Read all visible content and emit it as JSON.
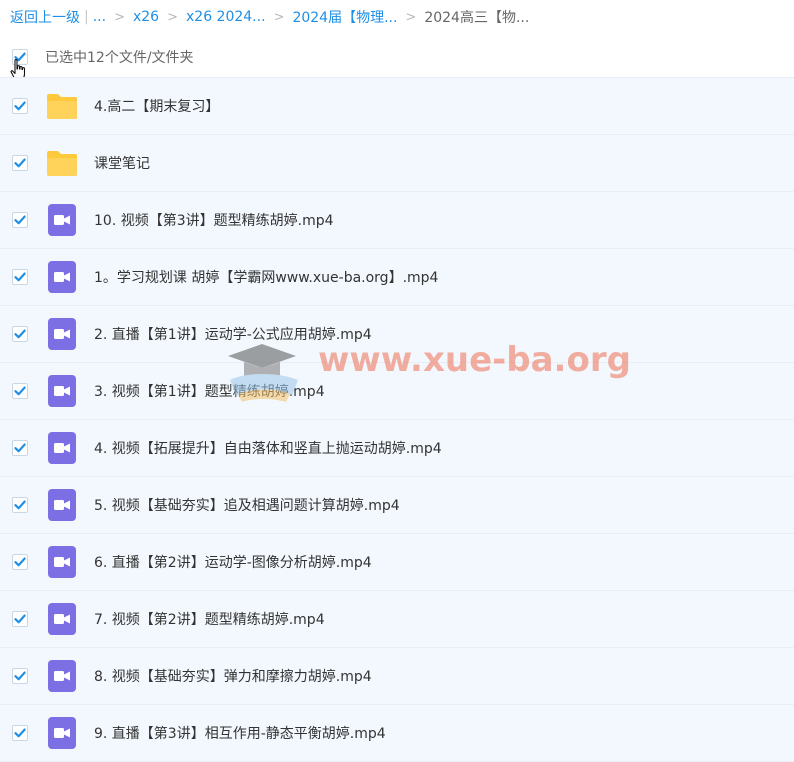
{
  "breadcrumb": {
    "back": "返回上一级",
    "ellipsis": "...",
    "items": [
      "x26",
      "x26 2024...",
      "2024届【物理...",
      "2024高三【物..."
    ]
  },
  "selection": {
    "count_text": "已选中12个文件/文件夹"
  },
  "icons": {
    "folder": "folder-icon",
    "video": "video-file-icon",
    "check": "check-icon"
  },
  "colors": {
    "accent": "#1f8fe5",
    "folder": "#ffc93c",
    "video": "#7b6fe3",
    "row_bg": "#f3f8fe"
  },
  "files": [
    {
      "type": "folder",
      "name": "4.高二【期末复习】"
    },
    {
      "type": "folder",
      "name": "课堂笔记"
    },
    {
      "type": "video",
      "name": "10. 视频【第3讲】题型精练胡婷.mp4"
    },
    {
      "type": "video",
      "name": "1。学习规划课 胡婷【学霸网www.xue-ba.org】.mp4"
    },
    {
      "type": "video",
      "name": "2. 直播【第1讲】运动学-公式应用胡婷.mp4"
    },
    {
      "type": "video",
      "name": "3. 视频【第1讲】题型精练胡婷.mp4"
    },
    {
      "type": "video",
      "name": "4. 视频【拓展提升】自由落体和竖直上抛运动胡婷.mp4"
    },
    {
      "type": "video",
      "name": "5. 视频【基础夯实】追及相遇问题计算胡婷.mp4"
    },
    {
      "type": "video",
      "name": "6. 直播【第2讲】运动学-图像分析胡婷.mp4"
    },
    {
      "type": "video",
      "name": "7. 视频【第2讲】题型精练胡婷.mp4"
    },
    {
      "type": "video",
      "name": "8. 视频【基础夯实】弹力和摩擦力胡婷.mp4"
    },
    {
      "type": "video",
      "name": "9. 直播【第3讲】相互作用-静态平衡胡婷.mp4"
    }
  ],
  "watermark": {
    "text": "www.xue-ba.org"
  }
}
